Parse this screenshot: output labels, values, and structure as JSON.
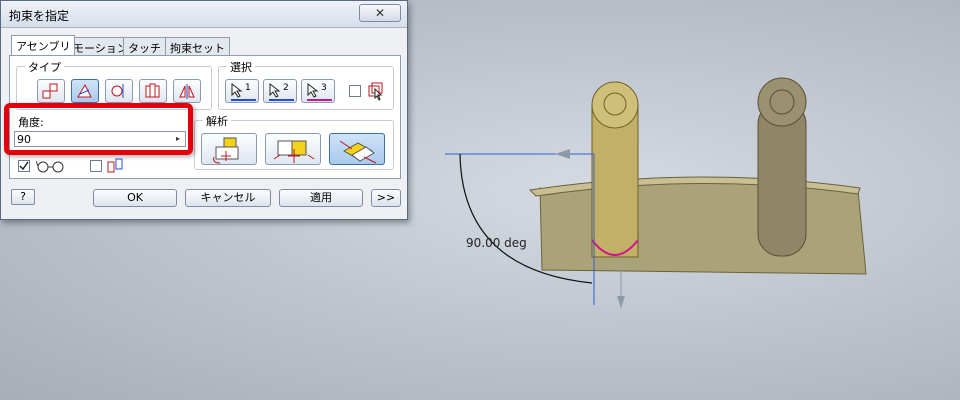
{
  "dialog": {
    "title": "拘束を指定",
    "close_glyph": "✕",
    "tabs": [
      {
        "label": "アセンブリ",
        "active": true
      },
      {
        "label": "モーション",
        "active": false
      },
      {
        "label": "タッチ",
        "active": false
      },
      {
        "label": "拘束セット",
        "active": false
      }
    ],
    "type_group_label": "タイプ",
    "type_buttons": [
      {
        "icon": "mate-icon",
        "pressed": false
      },
      {
        "icon": "angle-icon",
        "pressed": true
      },
      {
        "icon": "tangent-icon",
        "pressed": false
      },
      {
        "icon": "insert-icon",
        "pressed": false
      },
      {
        "icon": "symmetry-icon",
        "pressed": false
      }
    ],
    "selection_group_label": "選択",
    "selection_buttons": [
      {
        "label": "1",
        "color": "#1f4fd8"
      },
      {
        "label": "2",
        "color": "#1f4fd8"
      },
      {
        "label": "3",
        "color": "#c2188a"
      }
    ],
    "angle_label": "角度:",
    "angle_value": "90",
    "spin_glyph": "▸",
    "solution_group_label": "解析",
    "solution_buttons": [
      {
        "icon": "directed-angle-icon",
        "pressed": false
      },
      {
        "icon": "undirected-angle-icon",
        "pressed": false
      },
      {
        "icon": "explicit-reference-vector-icon",
        "pressed": true
      }
    ],
    "show_preview_icon": "glasses-icon",
    "predict_offset_icon": "offset-icon",
    "buttons": {
      "help": "?",
      "ok": "OK",
      "cancel": "キャンセル",
      "apply": "適用",
      "more": ">>"
    }
  },
  "viewport": {
    "dimension_text": "90.00 deg",
    "colors": {
      "highlight": "#e3000b",
      "part": "#b8ae7c",
      "axis": "#2f5fd0",
      "selected_edge": "#d0168b"
    }
  }
}
